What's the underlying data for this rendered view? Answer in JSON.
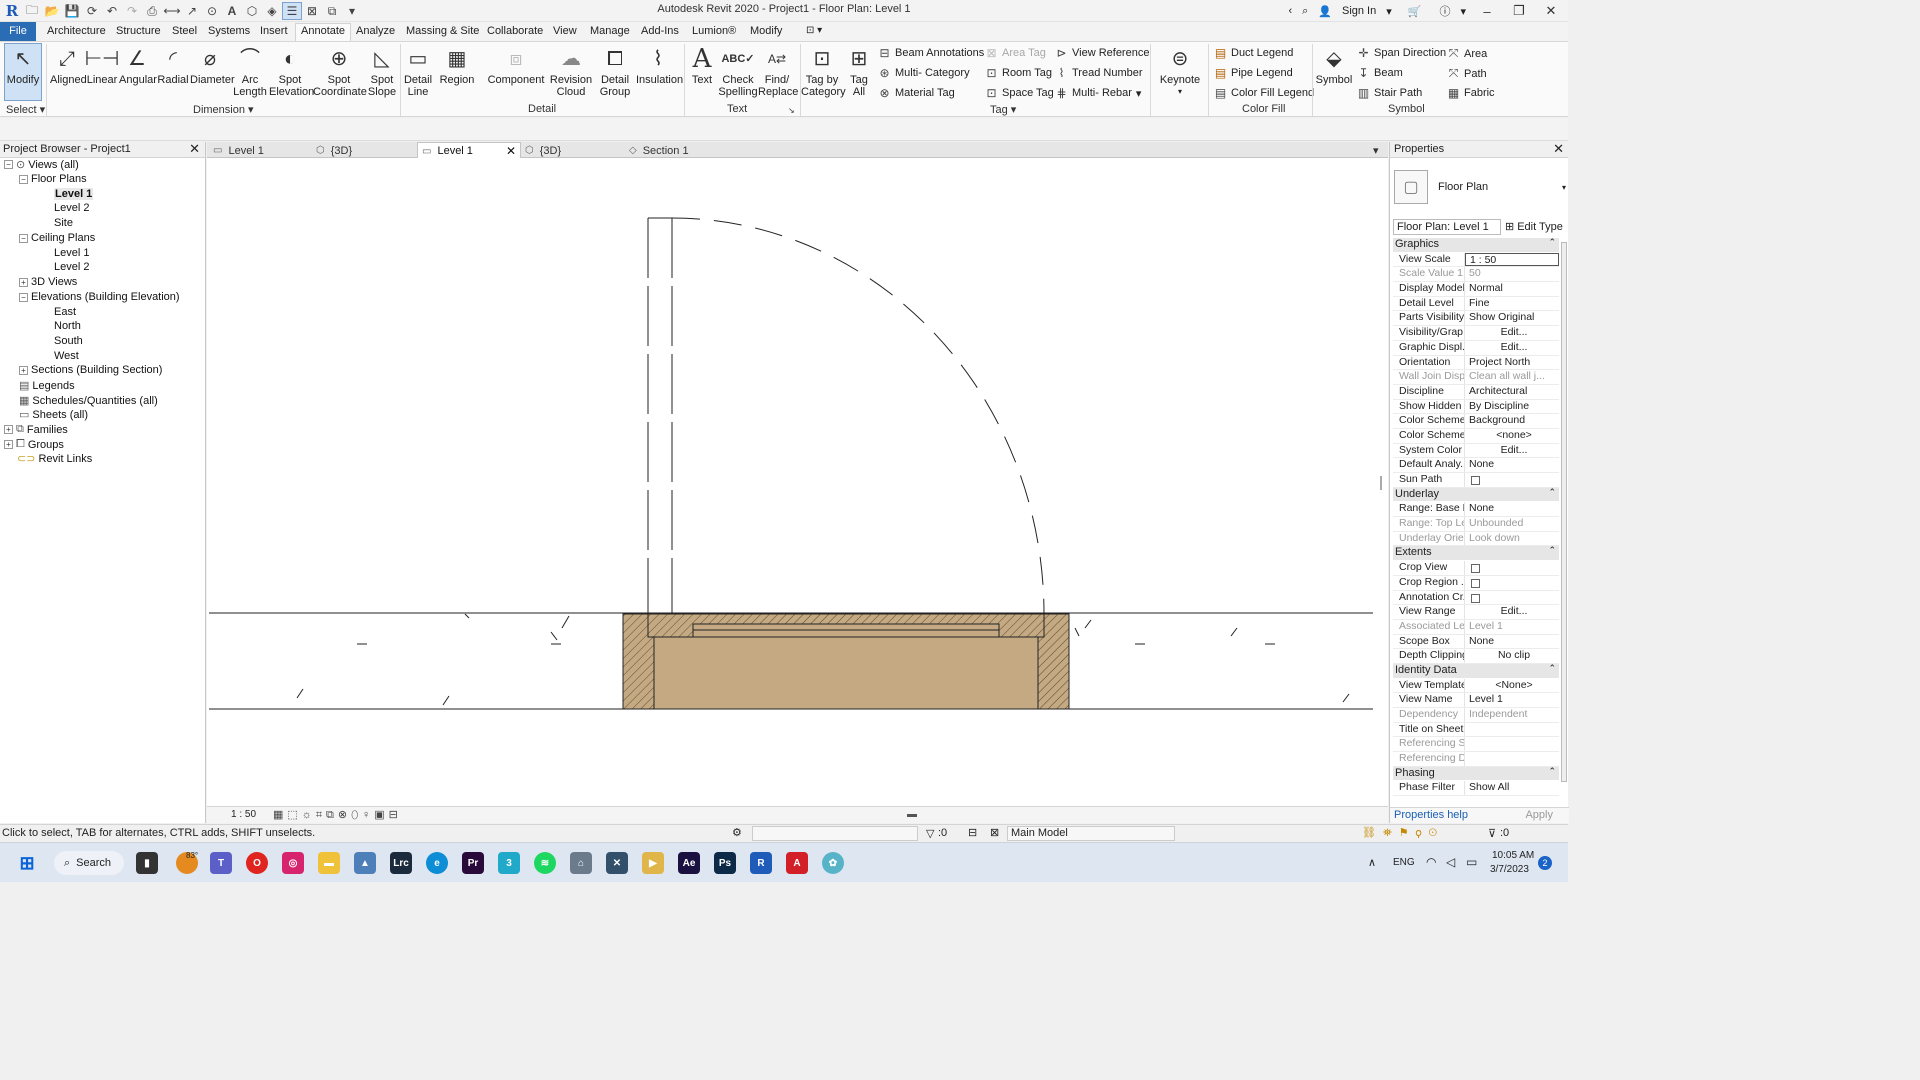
{
  "app": {
    "title": "Autodesk Revit 2020 - Project1 - Floor Plan: Level 1",
    "sign_in": "Sign In"
  },
  "ribbon_tabs": [
    "File",
    "Architecture",
    "Structure",
    "Steel",
    "Systems",
    "Insert",
    "Annotate",
    "Analyze",
    "Massing & Site",
    "Collaborate",
    "View",
    "Manage",
    "Add-Ins",
    "Lumion®",
    "Modify"
  ],
  "active_ribbon_tab": "Annotate",
  "ribbon": {
    "modify": "Modify",
    "select_label": "Select",
    "dimension_tools": [
      "Aligned",
      "Linear",
      "Angular",
      "Radial",
      "Diameter",
      "Arc Length",
      "Spot Elevation",
      "Spot Coordinate",
      "Spot Slope"
    ],
    "dimension_label": "Dimension",
    "detail_tools": [
      "Detail Line",
      "Region",
      "Component",
      "Revision Cloud",
      "Detail Group",
      "Insulation"
    ],
    "detail_label": "Detail",
    "text_tools": [
      "Text",
      "Check Spelling",
      "Find/ Replace"
    ],
    "text_label": "Text",
    "tag_big": [
      "Tag by Category",
      "Tag All"
    ],
    "tag_small": [
      "Beam Annotations",
      "Area Tag",
      "View Reference",
      "Multi- Category",
      "Room Tag",
      "Tread Number",
      "Material Tag",
      "Space Tag",
      "Multi- Rebar"
    ],
    "tag_label": "Tag",
    "keynote": "Keynote",
    "color_fill_small": [
      "Duct Legend",
      "Pipe Legend",
      "Color Fill Legend"
    ],
    "color_fill_label": "Color Fill",
    "symbol": "Symbol",
    "symbol_small": [
      "Span Direction",
      "Area",
      "Beam",
      "Path",
      "Stair Path",
      "Fabric"
    ],
    "symbol_label": "Symbol"
  },
  "project_browser": {
    "title": "Project Browser - Project1",
    "nodes": [
      {
        "label": "Views (all)"
      },
      {
        "label": "Floor Plans"
      },
      {
        "label": "Level 1"
      },
      {
        "label": "Level 2"
      },
      {
        "label": "Site"
      },
      {
        "label": "Ceiling Plans"
      },
      {
        "label": "Level 1"
      },
      {
        "label": "Level 2"
      },
      {
        "label": "3D Views"
      },
      {
        "label": "Elevations (Building Elevation)"
      },
      {
        "label": "East"
      },
      {
        "label": "North"
      },
      {
        "label": "South"
      },
      {
        "label": "West"
      },
      {
        "label": "Sections (Building Section)"
      },
      {
        "label": "Legends"
      },
      {
        "label": "Schedules/Quantities (all)"
      },
      {
        "label": "Sheets (all)"
      },
      {
        "label": "Families"
      },
      {
        "label": "Groups"
      },
      {
        "label": "Revit Links"
      }
    ]
  },
  "view_tabs": [
    "Level 1",
    "{3D}",
    "Level 1",
    "{3D}",
    "Section 1"
  ],
  "active_view_tab": 2,
  "view_control": {
    "scale": "1 : 50"
  },
  "properties": {
    "title": "Properties",
    "type_name": "Floor Plan",
    "instance": "Floor Plan: Level 1",
    "edit_type": "Edit Type",
    "groups": [
      {
        "name": "Graphics",
        "rows": [
          {
            "k": "View Scale",
            "v": "1 : 50"
          },
          {
            "k": "Scale Value   1:",
            "v": "50"
          },
          {
            "k": "Display Model",
            "v": "Normal"
          },
          {
            "k": "Detail Level",
            "v": "Fine"
          },
          {
            "k": "Parts Visibility",
            "v": "Show Original"
          },
          {
            "k": "Visibility/Grap...",
            "v": "Edit..."
          },
          {
            "k": "Graphic Displ...",
            "v": "Edit..."
          },
          {
            "k": "Orientation",
            "v": "Project North"
          },
          {
            "k": "Wall Join Disp...",
            "v": "Clean all wall j..."
          },
          {
            "k": "Discipline",
            "v": "Architectural"
          },
          {
            "k": "Show Hidden ...",
            "v": "By Discipline"
          },
          {
            "k": "Color Scheme...",
            "v": "Background"
          },
          {
            "k": "Color Scheme",
            "v": "<none>"
          },
          {
            "k": "System Color ...",
            "v": "Edit..."
          },
          {
            "k": "Default Analy...",
            "v": "None"
          },
          {
            "k": "Sun Path",
            "v": ""
          }
        ]
      },
      {
        "name": "Underlay",
        "rows": [
          {
            "k": "Range: Base L...",
            "v": "None"
          },
          {
            "k": "Range: Top Le...",
            "v": "Unbounded"
          },
          {
            "k": "Underlay Orie...",
            "v": "Look down"
          }
        ]
      },
      {
        "name": "Extents",
        "rows": [
          {
            "k": "Crop View",
            "v": ""
          },
          {
            "k": "Crop Region ...",
            "v": ""
          },
          {
            "k": "Annotation Cr...",
            "v": ""
          },
          {
            "k": "View Range",
            "v": "Edit..."
          },
          {
            "k": "Associated Le...",
            "v": "Level 1"
          },
          {
            "k": "Scope Box",
            "v": "None"
          },
          {
            "k": "Depth Clipping",
            "v": "No clip"
          }
        ]
      },
      {
        "name": "Identity Data",
        "rows": [
          {
            "k": "View Template",
            "v": "<None>"
          },
          {
            "k": "View Name",
            "v": "Level 1"
          },
          {
            "k": "Dependency",
            "v": "Independent"
          },
          {
            "k": "Title on Sheet",
            "v": ""
          },
          {
            "k": "Referencing S...",
            "v": ""
          },
          {
            "k": "Referencing D...",
            "v": ""
          }
        ]
      },
      {
        "name": "Phasing",
        "rows": [
          {
            "k": "Phase Filter",
            "v": "Show All"
          }
        ]
      }
    ],
    "help_link": "Properties help",
    "apply": "Apply"
  },
  "status": {
    "message": "Click to select, TAB for alternates, CTRL adds, SHIFT unselects.",
    "model": "Main Model",
    "count": ":0",
    "filter": ":0"
  },
  "taskbar": {
    "search": "Search",
    "weather": "83°",
    "lang": "ENG",
    "time": "10:05 AM",
    "date": "3/7/2023",
    "notif": "2"
  }
}
